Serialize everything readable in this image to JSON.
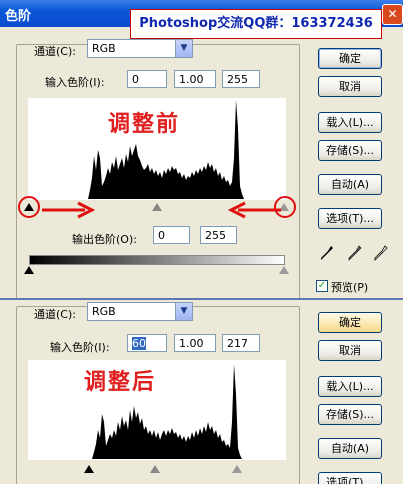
{
  "window": {
    "title": "色阶",
    "close_glyph": "✕"
  },
  "watermark": "Photoshop交流QQ群：163372436",
  "top": {
    "channel_label": "通道(C):",
    "channel_value": "RGB",
    "input_label": "输入色阶(I):",
    "input_values": [
      "0",
      "1.00",
      "255"
    ],
    "annotation": "调整前",
    "output_label": "输出色阶(O):",
    "output_values": [
      "0",
      "255"
    ],
    "buttons": {
      "ok": "确定",
      "cancel": "取消",
      "load": "载入(L)...",
      "save": "存储(S)...",
      "auto": "自动(A)",
      "options": "选项(T)..."
    },
    "preview_label": "预览(P)",
    "preview_checked": true
  },
  "bottom": {
    "channel_label": "通道(C):",
    "channel_value": "RGB",
    "input_label": "输入色阶(I):",
    "input_values": [
      "60",
      "1.00",
      "217"
    ],
    "annotation": "调整后",
    "buttons": {
      "ok": "确定",
      "cancel": "取消",
      "load": "载入(L)...",
      "save": "存储(S)...",
      "auto": "自动(A)",
      "options": "选项(T)..."
    }
  },
  "colors": {
    "annotation": "#e02020",
    "title_bar": "#0a56d8"
  },
  "icons": [
    "close-icon",
    "chevron-down-icon",
    "black-eyedropper-icon",
    "gray-eyedropper-icon",
    "white-eyedropper-icon",
    "red-arrow-icon"
  ]
}
